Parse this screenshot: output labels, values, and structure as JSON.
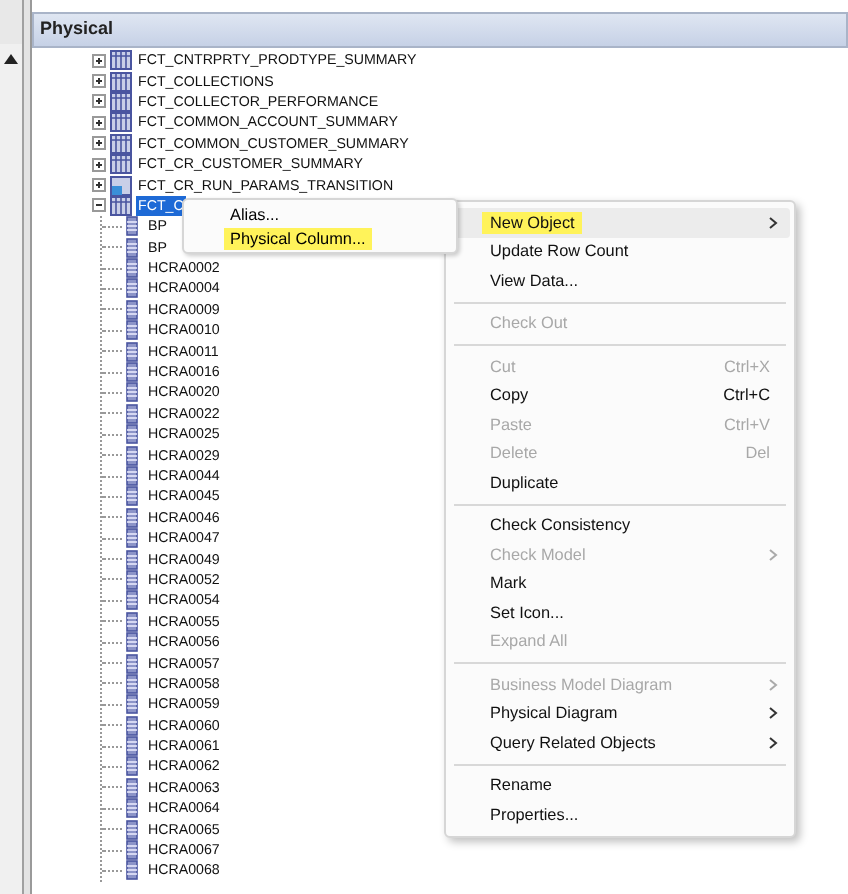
{
  "panel": {
    "title": "Physical"
  },
  "tree": [
    {
      "label": "FCT_CNTRPRTY_PRODTYPE_SUMMARY",
      "kind": "table",
      "expanded": false,
      "selected": false
    },
    {
      "label": "FCT_COLLECTIONS",
      "kind": "table",
      "expanded": false,
      "selected": false
    },
    {
      "label": "FCT_COLLECTOR_PERFORMANCE",
      "kind": "table",
      "expanded": false,
      "selected": false
    },
    {
      "label": "FCT_COMMON_ACCOUNT_SUMMARY",
      "kind": "table",
      "expanded": false,
      "selected": false
    },
    {
      "label": "FCT_COMMON_CUSTOMER_SUMMARY",
      "kind": "table",
      "expanded": false,
      "selected": false
    },
    {
      "label": "FCT_CR_CUSTOMER_SUMMARY",
      "kind": "table",
      "expanded": false,
      "selected": false
    },
    {
      "label": "FCT_CR_RUN_PARAMS_TRANSITION",
      "kind": "alias",
      "expanded": false,
      "selected": false
    },
    {
      "label": "FCT_C",
      "kind": "table",
      "expanded": true,
      "selected": true,
      "children": [
        {
          "label": "BP"
        },
        {
          "label": "BP"
        },
        {
          "label": "HCRA0002"
        },
        {
          "label": "HCRA0004"
        },
        {
          "label": "HCRA0009"
        },
        {
          "label": "HCRA0010"
        },
        {
          "label": "HCRA0011"
        },
        {
          "label": "HCRA0016"
        },
        {
          "label": "HCRA0020"
        },
        {
          "label": "HCRA0022"
        },
        {
          "label": "HCRA0025"
        },
        {
          "label": "HCRA0029"
        },
        {
          "label": "HCRA0044"
        },
        {
          "label": "HCRA0045"
        },
        {
          "label": "HCRA0046"
        },
        {
          "label": "HCRA0047"
        },
        {
          "label": "HCRA0049"
        },
        {
          "label": "HCRA0052"
        },
        {
          "label": "HCRA0054"
        },
        {
          "label": "HCRA0055"
        },
        {
          "label": "HCRA0056"
        },
        {
          "label": "HCRA0057"
        },
        {
          "label": "HCRA0058"
        },
        {
          "label": "HCRA0059"
        },
        {
          "label": "HCRA0060"
        },
        {
          "label": "HCRA0061"
        },
        {
          "label": "HCRA0062"
        },
        {
          "label": "HCRA0063"
        },
        {
          "label": "HCRA0064"
        },
        {
          "label": "HCRA0065"
        },
        {
          "label": "HCRA0067"
        },
        {
          "label": "HCRA0068"
        }
      ]
    }
  ],
  "context_menu": {
    "items": [
      {
        "kind": "item",
        "label": "New Object",
        "disabled": false,
        "highlighted": true,
        "submenu": true
      },
      {
        "kind": "item",
        "label": "Update Row Count",
        "disabled": false,
        "highlighted": false,
        "submenu": false
      },
      {
        "kind": "item",
        "label": "View Data...",
        "disabled": false,
        "highlighted": false,
        "submenu": false
      },
      {
        "kind": "separator"
      },
      {
        "kind": "item",
        "label": "Check Out",
        "disabled": true,
        "highlighted": false,
        "submenu": false
      },
      {
        "kind": "separator"
      },
      {
        "kind": "item",
        "label": "Cut",
        "shortcut": "Ctrl+X",
        "disabled": true,
        "highlighted": false,
        "submenu": false
      },
      {
        "kind": "item",
        "label": "Copy",
        "shortcut": "Ctrl+C",
        "disabled": false,
        "highlighted": false,
        "submenu": false
      },
      {
        "kind": "item",
        "label": "Paste",
        "shortcut": "Ctrl+V",
        "disabled": true,
        "highlighted": false,
        "submenu": false
      },
      {
        "kind": "item",
        "label": "Delete",
        "shortcut": "Del",
        "disabled": true,
        "highlighted": false,
        "submenu": false
      },
      {
        "kind": "item",
        "label": "Duplicate",
        "disabled": false,
        "highlighted": false,
        "submenu": false
      },
      {
        "kind": "separator"
      },
      {
        "kind": "item",
        "label": "Check Consistency",
        "disabled": false,
        "highlighted": false,
        "submenu": false
      },
      {
        "kind": "item",
        "label": "Check Model",
        "disabled": true,
        "highlighted": false,
        "submenu": true
      },
      {
        "kind": "item",
        "label": "Mark",
        "disabled": false,
        "highlighted": false,
        "submenu": false
      },
      {
        "kind": "item",
        "label": "Set Icon...",
        "disabled": false,
        "highlighted": false,
        "submenu": false
      },
      {
        "kind": "item",
        "label": "Expand All",
        "disabled": true,
        "highlighted": false,
        "submenu": false
      },
      {
        "kind": "separator"
      },
      {
        "kind": "item",
        "label": "Business Model Diagram",
        "disabled": true,
        "highlighted": false,
        "submenu": true
      },
      {
        "kind": "item",
        "label": "Physical Diagram",
        "disabled": false,
        "highlighted": false,
        "submenu": true
      },
      {
        "kind": "item",
        "label": "Query Related Objects",
        "disabled": false,
        "highlighted": false,
        "submenu": true
      },
      {
        "kind": "separator"
      },
      {
        "kind": "item",
        "label": "Rename",
        "disabled": false,
        "highlighted": false,
        "submenu": false
      },
      {
        "kind": "item",
        "label": "Properties...",
        "disabled": false,
        "highlighted": false,
        "submenu": false
      }
    ]
  },
  "submenu": {
    "items": [
      {
        "label": "Alias...",
        "highlighted": false
      },
      {
        "label": "Physical Column...",
        "highlighted": true
      }
    ]
  }
}
